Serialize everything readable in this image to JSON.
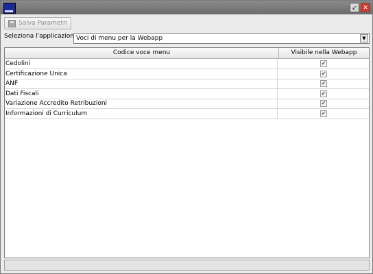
{
  "window": {
    "title": ""
  },
  "toolbar": {
    "save_label": "Salva Parametri"
  },
  "selector": {
    "label": "Seleziona l'applicazione",
    "value": "Voci di menu per la Webapp"
  },
  "table": {
    "columns": [
      "Codice voce menu",
      "Visibile nella Webapp"
    ],
    "rows": [
      {
        "name": "Cedolini",
        "visible": true
      },
      {
        "name": "Certificazione Unica",
        "visible": true
      },
      {
        "name": "ANF",
        "visible": true
      },
      {
        "name": "Dati Fiscali",
        "visible": true
      },
      {
        "name": "Variazione Accredito Retribuzioni",
        "visible": true
      },
      {
        "name": "Informazioni di Curriculum",
        "visible": true
      }
    ]
  }
}
